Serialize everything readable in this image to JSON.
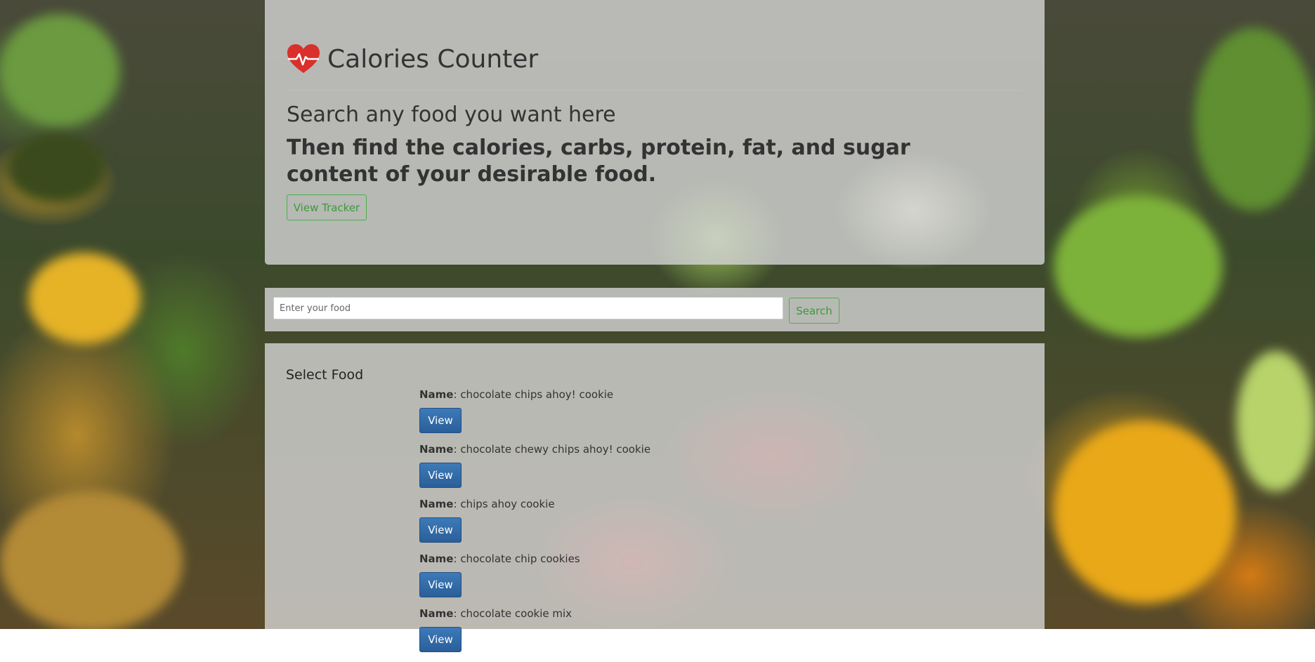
{
  "app": {
    "title": "Calories Counter",
    "heart_icon": "heart-pulse-icon",
    "heart_color": "#d9302c"
  },
  "hero": {
    "tagline": "Search any food you want here",
    "description": "Then find the calories, carbs, protein, fat, and sugar content of your desirable food.",
    "view_tracker_label": "View Tracker"
  },
  "search": {
    "placeholder": "Enter your food",
    "value": "",
    "button_label": "Search"
  },
  "results": {
    "heading": "Select Food",
    "name_label": "Name",
    "view_label": "View",
    "items": [
      {
        "name": "chocolate chips ahoy! cookie"
      },
      {
        "name": "chocolate chewy chips ahoy! cookie"
      },
      {
        "name": "chips ahoy cookie"
      },
      {
        "name": "chocolate chip cookies"
      },
      {
        "name": "chocolate cookie mix"
      }
    ]
  },
  "colors": {
    "accent_green": "#4cae4c",
    "primary_blue": "#337ab7"
  }
}
